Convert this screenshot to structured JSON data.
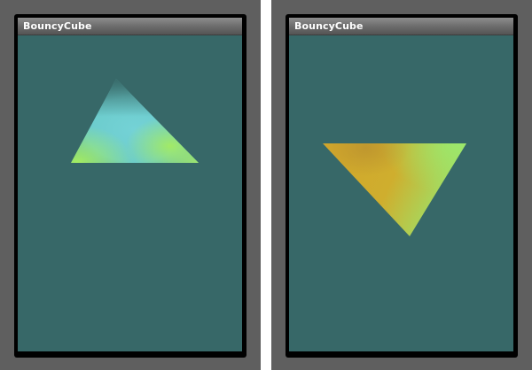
{
  "windows": [
    {
      "title": "BouncyCube",
      "background_color": "#376868",
      "shape": {
        "kind": "triangle",
        "orientation": "pointing-up",
        "colors": [
          "#6fd0d2",
          "#9fe86a",
          "#3a6666"
        ]
      }
    },
    {
      "title": "BouncyCube",
      "background_color": "#376868",
      "shape": {
        "kind": "triangle",
        "orientation": "pointing-down",
        "colors": [
          "#d4a82a",
          "#9ee56a"
        ]
      }
    }
  ]
}
